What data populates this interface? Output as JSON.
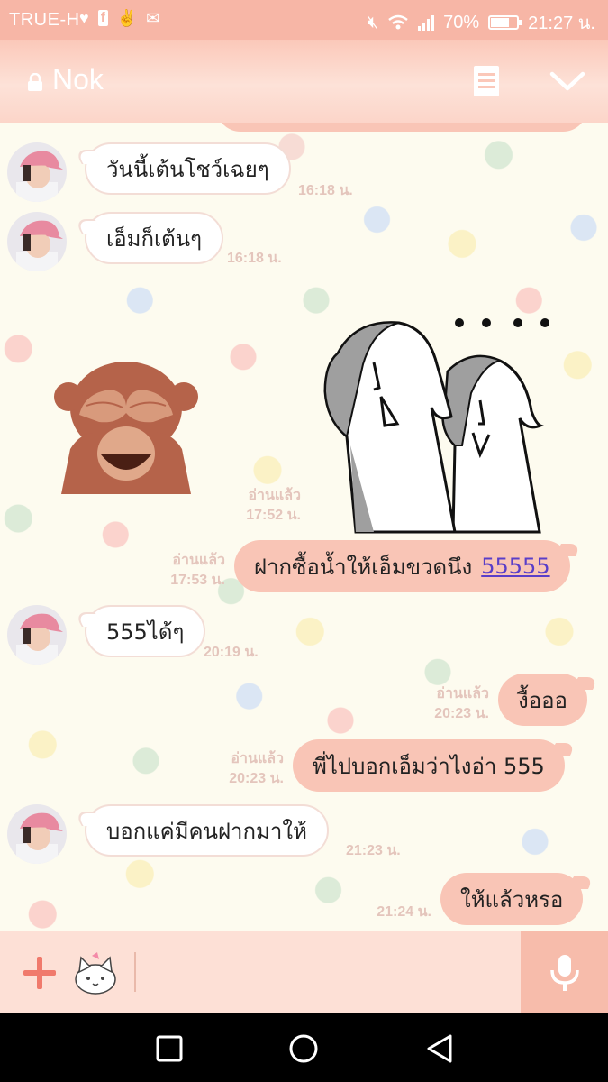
{
  "status_bar": {
    "carrier": "TRUE-H",
    "battery": "70%",
    "battery_level": 0.7,
    "time": "21:27 น."
  },
  "header": {
    "title": "Nok",
    "icons": [
      "lock-icon",
      "notes-icon",
      "chevron-down-icon"
    ]
  },
  "colors": {
    "header": "#fbc8b9",
    "outgoing_bubble": "#f9c5b6",
    "incoming_bubble": "#ffffff",
    "meta_text": "#e4c5bc",
    "accent": "#f07a6c"
  },
  "messages": [
    {
      "side": "in",
      "text": "วันนี้เต้นโชว์เฉยๆ",
      "time": "16:18 น."
    },
    {
      "side": "in",
      "text": "เอ็มก็เต้นๆ",
      "time": "16:18 น."
    },
    {
      "side": "in",
      "sticker": "monkey-covering-eyes-sticker"
    },
    {
      "side": "out",
      "sticker": "two-girls-whispering-sticker",
      "read": "อ่านแล้ว",
      "time": "17:52 น."
    },
    {
      "side": "out",
      "text": "ฝากซื้อน้ำให้เอ็มขวดนึง",
      "link": "55555",
      "read": "อ่านแล้ว",
      "time": "17:53 น."
    },
    {
      "side": "in",
      "text": "555ได้ๆ",
      "time": "20:19 น."
    },
    {
      "side": "out",
      "text": "งื้อออ",
      "read": "อ่านแล้ว",
      "time": "20:23 น."
    },
    {
      "side": "out",
      "text": "พี่ไปบอกเอ็มว่าไงอ่า 555",
      "read": "อ่านแล้ว",
      "time": "20:23 น."
    },
    {
      "side": "in",
      "text": "บอกแค่มีคนฝากมาให้",
      "time": "21:23 น."
    },
    {
      "side": "out",
      "text": "ให้แล้วหรอ",
      "time": "21:24 น."
    }
  ],
  "input_bar": {
    "icons": [
      "plus-icon",
      "sticker-cat-icon",
      "microphone-icon"
    ]
  },
  "nav_bar": {
    "icons": [
      "recent-apps-icon",
      "home-icon",
      "back-icon"
    ]
  }
}
